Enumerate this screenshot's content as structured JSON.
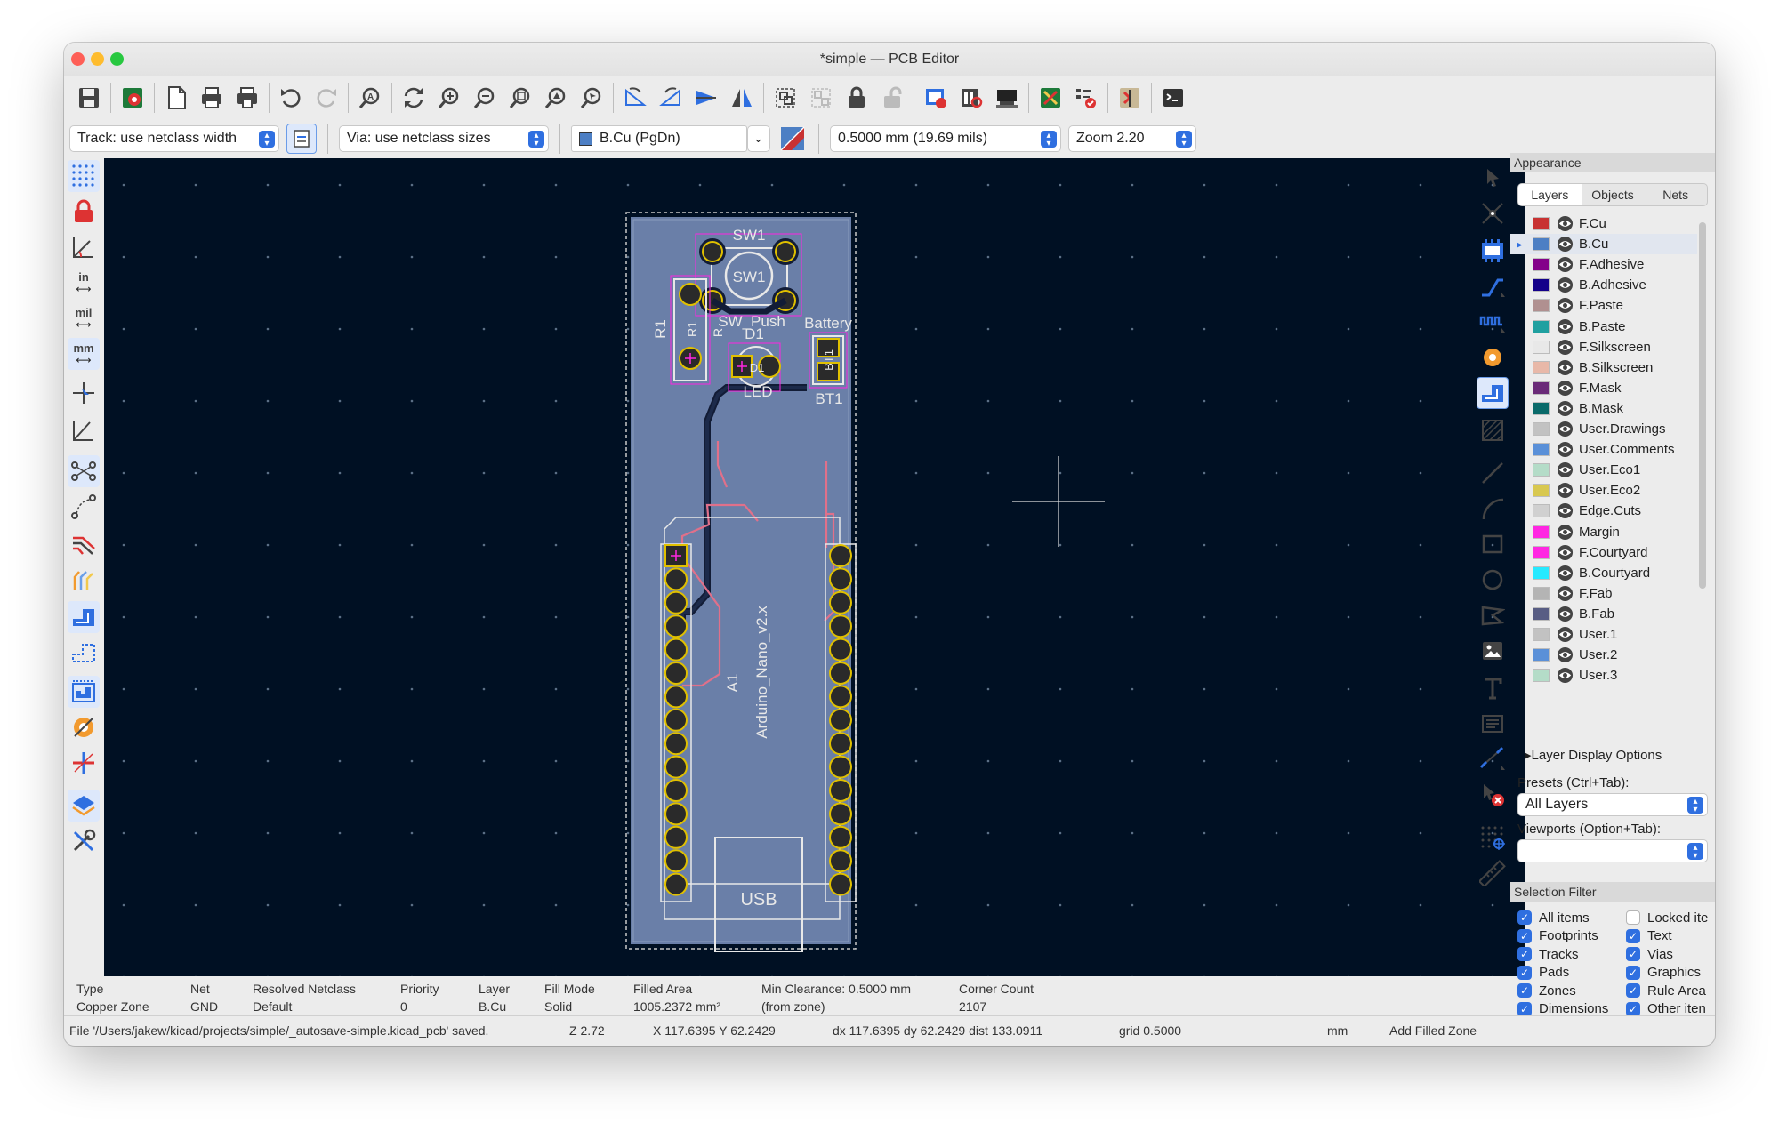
{
  "window": {
    "title": "*simple — PCB Editor"
  },
  "toolbar": {
    "track_width": "Track: use netclass width",
    "via_size": "Via: use netclass sizes",
    "layer": "B.Cu (PgDn)",
    "grid": "0.5000 mm (19.69 mils)",
    "zoom": "Zoom 2.20"
  },
  "left_toolbar": {
    "units_in": "in",
    "units_mil": "mil",
    "units_mm": "mm"
  },
  "board": {
    "ref_sw1": "SW1",
    "sw1_center": "SW1",
    "sw_value": "SW_Push",
    "ref_d1": "D1",
    "d1_center": "D1",
    "led_value": "LED",
    "battery_value": "Battery",
    "ref_bt1": "BT1",
    "bt1_center": "BT1",
    "ref_r1": "R1",
    "r1_center": "R1",
    "r_value": "R",
    "ref_a1": "A1",
    "module_value": "Arduino_Nano_v2.x",
    "usb": "USB"
  },
  "appearance": {
    "title": "Appearance",
    "tabs": [
      "Layers",
      "Objects",
      "Nets"
    ],
    "layers": [
      {
        "name": "F.Cu",
        "color": "#c83232"
      },
      {
        "name": "B.Cu",
        "color": "#4d7fc4"
      },
      {
        "name": "F.Adhesive",
        "color": "#84008a"
      },
      {
        "name": "B.Adhesive",
        "color": "#14008a"
      },
      {
        "name": "F.Paste",
        "color": "#b09090"
      },
      {
        "name": "B.Paste",
        "color": "#20a0a0"
      },
      {
        "name": "F.Silkscreen",
        "color": "#e8e8e8"
      },
      {
        "name": "B.Silkscreen",
        "color": "#e8b8a8"
      },
      {
        "name": "F.Mask",
        "color": "#6a2a78"
      },
      {
        "name": "B.Mask",
        "color": "#0a6a6a"
      },
      {
        "name": "User.Drawings",
        "color": "#c2c2c2"
      },
      {
        "name": "User.Comments",
        "color": "#5a90d8"
      },
      {
        "name": "User.Eco1",
        "color": "#b4dcc8"
      },
      {
        "name": "User.Eco2",
        "color": "#d8c850"
      },
      {
        "name": "Edge.Cuts",
        "color": "#d0d0d0"
      },
      {
        "name": "Margin",
        "color": "#ff26e2"
      },
      {
        "name": "F.Courtyard",
        "color": "#ff26e2"
      },
      {
        "name": "B.Courtyard",
        "color": "#26e9ff"
      },
      {
        "name": "F.Fab",
        "color": "#b4b4b4"
      },
      {
        "name": "B.Fab",
        "color": "#585d84"
      },
      {
        "name": "User.1",
        "color": "#c2c2c2"
      },
      {
        "name": "User.2",
        "color": "#5a90d8"
      },
      {
        "name": "User.3",
        "color": "#b4dcc8"
      }
    ],
    "layer_display_options": "Layer Display Options",
    "presets_label": "Presets (Ctrl+Tab):",
    "presets_value": "All Layers",
    "viewports_label": "Viewports (Option+Tab):",
    "viewports_value": ""
  },
  "selection_filter": {
    "title": "Selection Filter",
    "items_left": [
      {
        "label": "All items",
        "checked": true
      },
      {
        "label": "Footprints",
        "checked": true
      },
      {
        "label": "Tracks",
        "checked": true
      },
      {
        "label": "Pads",
        "checked": true
      },
      {
        "label": "Zones",
        "checked": true
      },
      {
        "label": "Dimensions",
        "checked": true
      }
    ],
    "items_right": [
      {
        "label": "Locked ite",
        "checked": false
      },
      {
        "label": "Text",
        "checked": true
      },
      {
        "label": "Vias",
        "checked": true
      },
      {
        "label": "Graphics",
        "checked": true
      },
      {
        "label": "Rule Area",
        "checked": true
      },
      {
        "label": "Other iten",
        "checked": true
      }
    ]
  },
  "message_panel": {
    "type_label": "Type",
    "type_value": "Copper Zone",
    "net_label": "Net",
    "net_value": "GND",
    "netclass_label": "Resolved Netclass",
    "netclass_value": "Default",
    "priority_label": "Priority",
    "priority_value": "0",
    "layer_label": "Layer",
    "layer_value": "B.Cu",
    "fill_label": "Fill Mode",
    "fill_value": "Solid",
    "area_label": "Filled Area",
    "area_value": "1005.2372 mm²",
    "clearance_label": "Min Clearance: 0.5000 mm",
    "clearance_value": "(from zone)",
    "corner_label": "Corner Count",
    "corner_value": "2107"
  },
  "status": {
    "message": "File '/Users/jakew/kicad/projects/simple/_autosave-simple.kicad_pcb' saved.",
    "zoom": "Z 2.72",
    "xy": "X 117.6395  Y 62.2429",
    "dxy": "dx 117.6395  dy 62.2429  dist 133.0911",
    "grid": "grid 0.5000",
    "units": "mm",
    "mode": "Add Filled Zone"
  }
}
